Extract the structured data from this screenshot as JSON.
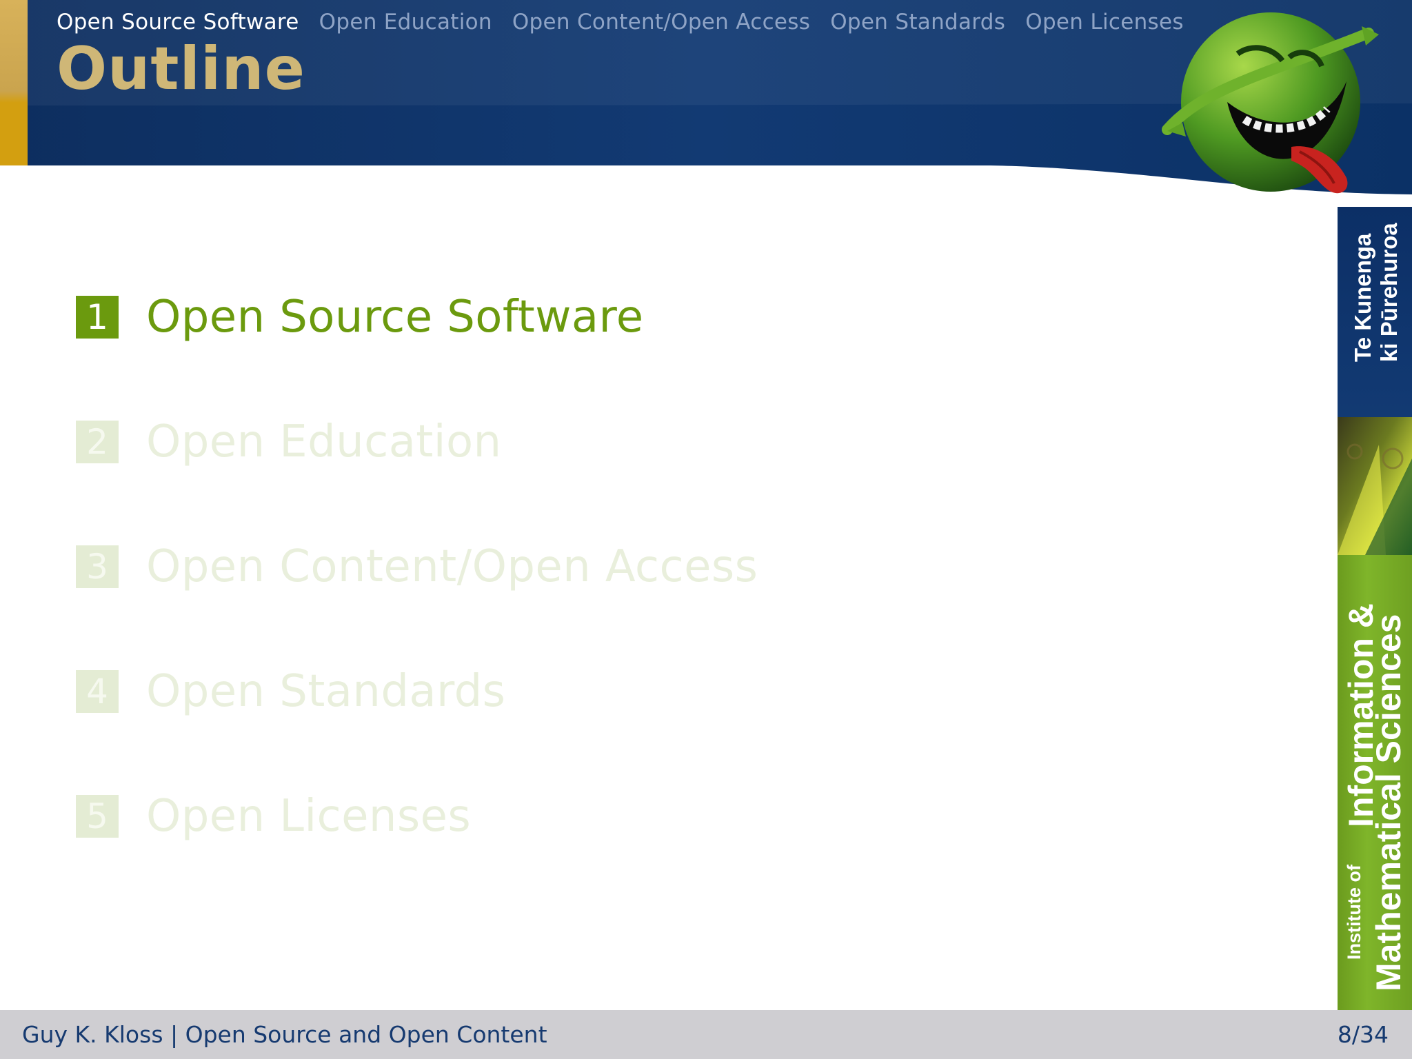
{
  "header": {
    "nav": [
      {
        "label": "Open Source Software",
        "active": true
      },
      {
        "label": "Open Education",
        "active": false
      },
      {
        "label": "Open Content/Open Access",
        "active": false
      },
      {
        "label": "Open Standards",
        "active": false
      },
      {
        "label": "Open Licenses",
        "active": false
      }
    ],
    "title": "Outline"
  },
  "toc": [
    {
      "number": "1",
      "label": "Open Source Software",
      "active": true
    },
    {
      "number": "2",
      "label": "Open Education",
      "active": false
    },
    {
      "number": "3",
      "label": "Open Content/Open Access",
      "active": false
    },
    {
      "number": "4",
      "label": "Open Standards",
      "active": false
    },
    {
      "number": "5",
      "label": "Open Licenses",
      "active": false
    }
  ],
  "sidebar": {
    "maori_line1": "Te Kunenga",
    "maori_line2": "ki Pūrehuroa",
    "institute_of": "Institute of",
    "info": "Information &",
    "maths": "Mathematical Sciences"
  },
  "footer": {
    "text": "Guy K. Kloss | Open Source and Open Content",
    "page": "8/34"
  },
  "colors": {
    "header_blue": "#0b3166",
    "title_gold": "#cfb777",
    "accent_green": "#6b9a0e",
    "footer_gray": "#cfced2"
  }
}
